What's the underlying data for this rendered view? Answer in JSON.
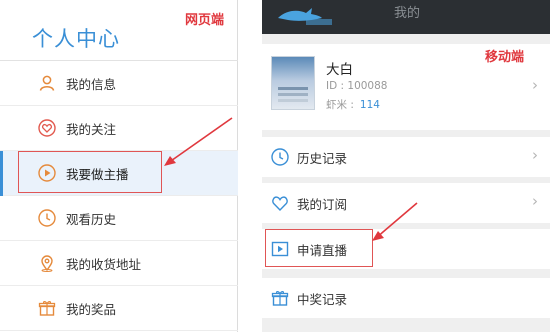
{
  "web": {
    "title": "个人中心",
    "callout": "网页端",
    "items": [
      {
        "label": "我的信息",
        "icon": "user-icon"
      },
      {
        "label": "我的关注",
        "icon": "heart-icon"
      },
      {
        "label": "我要做主播",
        "icon": "play-icon",
        "active": true
      },
      {
        "label": "观看历史",
        "icon": "clock-icon"
      },
      {
        "label": "我的收货地址",
        "icon": "location-icon"
      },
      {
        "label": "我的奖品",
        "icon": "gift-icon"
      }
    ]
  },
  "mobile": {
    "callout": "移动端",
    "topbar": {
      "title": "我的",
      "logo": "shark-logo"
    },
    "profile": {
      "name": "大白",
      "id_text": "ID : 100088",
      "shrimp_label": "虾米 :",
      "shrimp_value": "114"
    },
    "items": [
      {
        "label": "历史记录",
        "icon": "clock-icon"
      },
      {
        "label": "我的订阅",
        "icon": "heart-icon"
      },
      {
        "label": "申请直播",
        "icon": "play-icon"
      },
      {
        "label": "中奖记录",
        "icon": "gift-icon"
      }
    ]
  },
  "colors": {
    "accent": "#3a8fd6",
    "highlight": "#e05555",
    "topbar": "#2b2f33"
  }
}
